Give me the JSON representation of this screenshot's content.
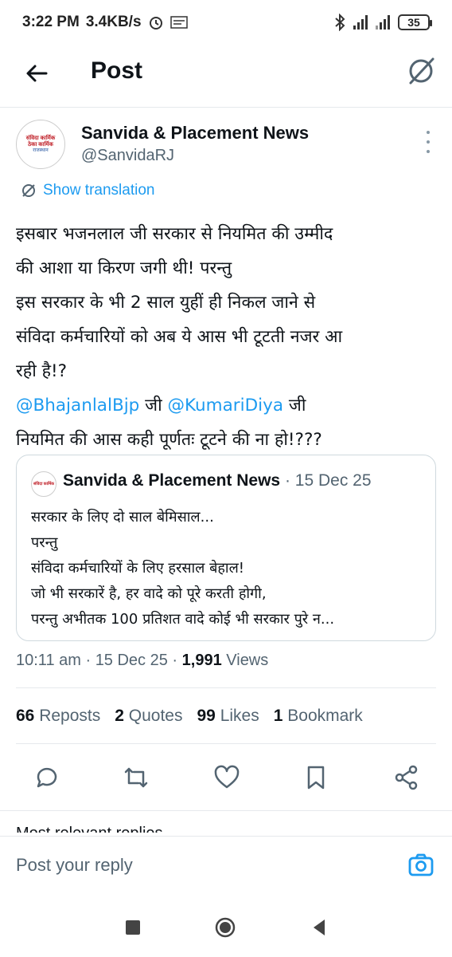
{
  "status_bar": {
    "time": "3:22 PM",
    "speed": "3.4KB/s",
    "battery": "35",
    "network": "4G"
  },
  "header": {
    "title": "Post"
  },
  "author": {
    "name": "Sanvida & Placement News",
    "handle": "@SanvidaRJ",
    "avatar_line1": "संविदा कार्मिक",
    "avatar_line2": "ठेका कार्मिक",
    "avatar_line3": "राजस्थान"
  },
  "translate": {
    "label": "Show translation"
  },
  "tweet": {
    "lines": [
      "इसबार भजनलाल जी सरकार से नियमित की उम्मीद",
      "की आशा या किरण जगी थी! परन्तु",
      "इस सरकार के भी 2 साल युहीं ही निकल जाने से",
      "संविदा कर्मचारियों को अब ये आस भी टूटती नजर आ",
      "रही है!?"
    ],
    "mention1": "@BhajanlalBjp",
    "mid_word": " जी ",
    "mention2": "@KumariDiya",
    "end_word": " जी",
    "last_line": "नियमित की आस कही पूर्णतः टूटने की ना हो!???"
  },
  "quote": {
    "name": "Sanvida & Placement News",
    "date": " · 15 Dec 25",
    "lines": [
      "सरकार के लिए दो साल बेमिसाल...",
      "परन्तु",
      "संविदा कर्मचारियों के लिए हरसाल बेहाल!",
      "जो भी सरकारें है, हर वादे को पूरे करती होगी,",
      "परन्तु अभीतक 100 प्रतिशत वादे कोई भी सरकार पुरे न..."
    ]
  },
  "meta": {
    "time": "10:11 am",
    "date": "15 Dec 25",
    "views_count": "1,991",
    "views_label": "Views"
  },
  "stats": {
    "reposts_count": "66",
    "reposts_label": "Reposts",
    "quotes_count": "2",
    "quotes_label": "Quotes",
    "likes_count": "99",
    "likes_label": "Likes",
    "bookmarks_count": "1",
    "bookmarks_label": "Bookmark"
  },
  "more_replies": "Most relevant replies",
  "reply": {
    "placeholder": "Post your reply"
  },
  "colors": {
    "accent": "#1d9bf0",
    "text": "#0f1419",
    "secondary": "#536471",
    "border": "#cfd9de"
  },
  "icons": [
    "arrow-left-icon",
    "grok-icon",
    "more-vertical-icon",
    "translate-icon",
    "reply-icon",
    "repost-icon",
    "like-icon",
    "bookmark-icon",
    "share-icon",
    "camera-icon",
    "nav-recents-icon",
    "nav-home-icon",
    "nav-back-icon"
  ]
}
